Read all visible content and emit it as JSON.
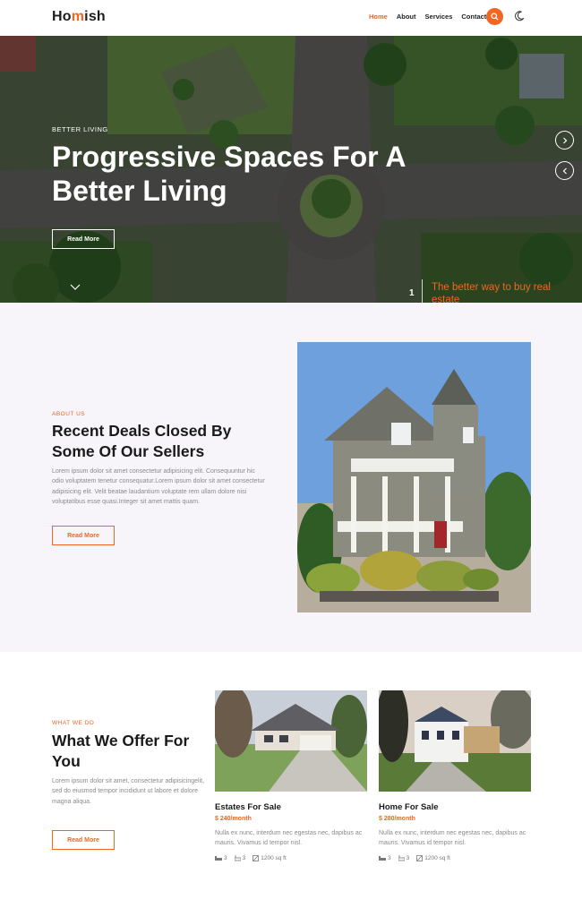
{
  "brand": {
    "name_prefix": "Ho",
    "name_accent": "m",
    "name_suffix": "ish",
    "accent_color": "#f26522"
  },
  "nav": {
    "items": [
      {
        "label": "Home",
        "active": true
      },
      {
        "label": "About",
        "active": false
      },
      {
        "label": "Services",
        "active": false
      },
      {
        "label": "Contact",
        "active": false
      }
    ],
    "search_icon": "search-icon",
    "theme_icon": "moon-icon"
  },
  "hero": {
    "eyebrow": "BETTER LIVING",
    "title": "Progressive Spaces For A Better Living",
    "button_label": "Read More",
    "slide_number": "1",
    "slide_caption": "The better way to buy real estate",
    "next_icon": "chevron-right-icon",
    "prev_icon": "chevron-left-icon",
    "scroll_icon": "chevron-down-icon"
  },
  "about": {
    "eyebrow": "ABOUT US",
    "title": "Recent Deals Closed By Some Of Our Sellers",
    "text": "Lorem ipsum dolor sit amet consectetur adipisicing elit. Consequuntur hic odio voluptatem tenetur consequatur.Lorem ipsum dolor sit amet consectetur adipisicing elit. Velit beatae laudantium voluptate rem ullam dolore nisi voluptatibus esse quasi.Integer sit amet mattis quam.",
    "button_label": "Read More"
  },
  "offer": {
    "eyebrow": "WHAT WE DO",
    "title": "What We Offer For You",
    "text": "Lorem ipsum dolor sit amet, consectetur adipisicingelit, sed do eiusmod tempor incididunt ut labore et dolore magna aliqua.",
    "button_label": "Read More",
    "cards": [
      {
        "title": "Estates For Sale",
        "price": "$ 240/month",
        "text": "Nulla ex nunc, interdum nec egestas nec, dapibus ac mauris. Vivamus id tempor nisl.",
        "beds": "3",
        "baths": "3",
        "area": "1200 sq ft"
      },
      {
        "title": "Home For Sale",
        "price": "$ 280/month",
        "text": "Nulla ex nunc, interdum nec egestas nec, dapibus ac mauris. Vivamus id tempor nisl.",
        "beds": "3",
        "baths": "3",
        "area": "1200 sq ft"
      }
    ]
  }
}
